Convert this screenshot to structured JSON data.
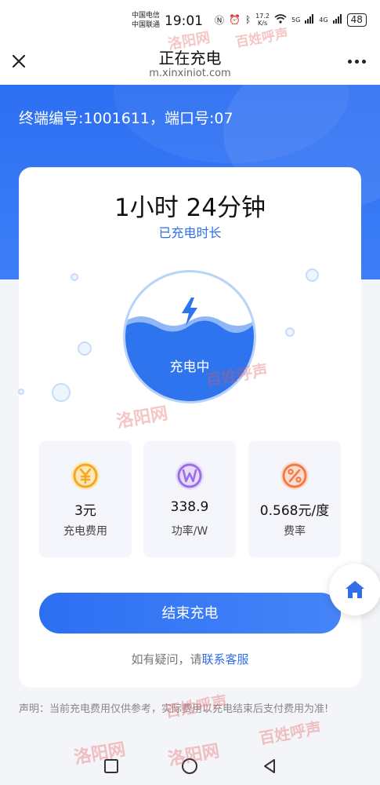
{
  "status_bar": {
    "carrier_1": "中国电信",
    "carrier_2": "中国联通",
    "time": "19:01",
    "speed_value": "17.2",
    "speed_unit": "K/s",
    "network_1": "5G",
    "network_2": "4G",
    "battery": "48"
  },
  "header": {
    "title": "正在充电",
    "url": "m.xinxiniot.com"
  },
  "device": {
    "info": "终端编号:1001611，端口号:07"
  },
  "charging": {
    "duration": "1小时 24分钟",
    "duration_label": "已充电时长",
    "status": "充电中"
  },
  "stats": [
    {
      "value": "3元",
      "label": "充电费用",
      "icon": "yuan-coin-icon",
      "color": "#f5a623"
    },
    {
      "value": "338.9",
      "label": "功率/W",
      "icon": "watt-coin-icon",
      "color": "#9b6ee8"
    },
    {
      "value": "0.568元/度",
      "label": "费率",
      "icon": "percent-coin-icon",
      "color": "#f07a4a"
    }
  ],
  "actions": {
    "end_charging": "结束充电",
    "help_prefix": "如有疑问，请",
    "help_link": "联系客服"
  },
  "footer": {
    "disclaimer": "声明：当前充电费用仅供参考，实际费用以充电结束后支付费用为准!"
  },
  "watermark": {
    "text_1": "洛阳网",
    "text_2": "百姓呼声"
  },
  "colors": {
    "primary": "#2d6ff2",
    "card": "#ffffff",
    "background": "#f4f5f9"
  }
}
